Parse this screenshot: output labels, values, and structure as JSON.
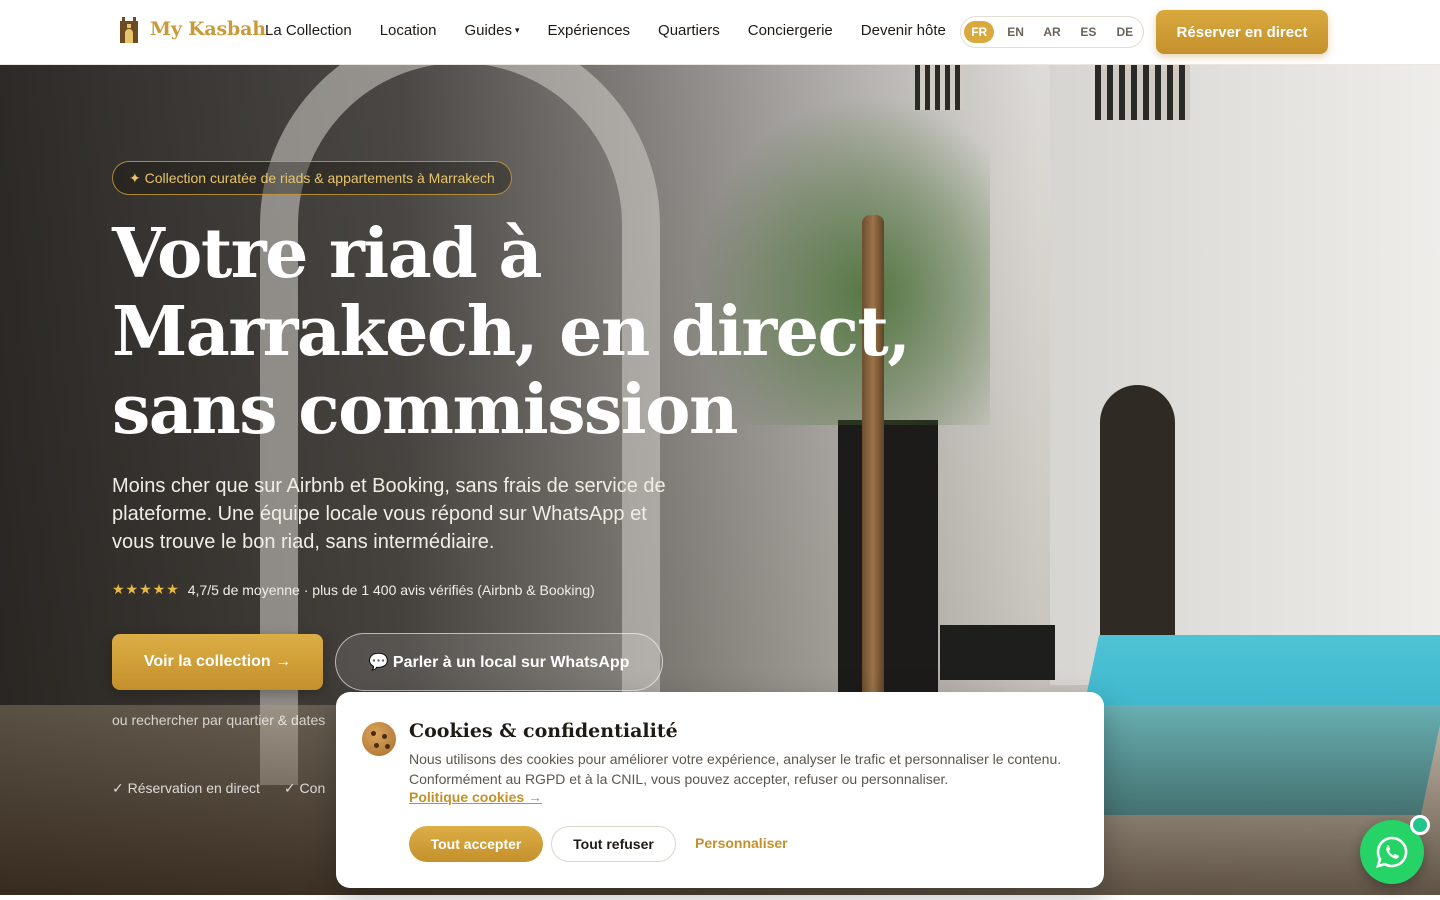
{
  "brand": {
    "name": "My Kasbah",
    "accent": "#d9a93d"
  },
  "nav": {
    "items": [
      "La Collection",
      "Location",
      "Guides",
      "Expériences",
      "Quartiers",
      "Conciergerie",
      "Devenir hôte"
    ],
    "guides_caret": "▾"
  },
  "lang": {
    "options": [
      "FR",
      "EN",
      "AR",
      "ES",
      "DE"
    ],
    "selected": "FR"
  },
  "header_cta": "Réserver en direct",
  "hero": {
    "badge": "✦ Collection curatée de riads & appartements à Marrakech",
    "title": "Votre riad à Marrakech, en direct, sans commission",
    "subtitle": "Moins cher que sur Airbnb et Booking, sans frais de service de plateforme. Une équipe locale vous répond sur WhatsApp et vous trouve le bon riad, sans intermédiaire.",
    "stars": "★★★★★",
    "rating_text": "4,7/5 de moyenne · plus de 1 400 avis vérifiés (Airbnb & Booking)",
    "primary_button": "Voir la collection →",
    "secondary_button": "💬 Parler à un local sur WhatsApp",
    "search_link": "ou rechercher par quartier & dates",
    "checks": [
      "✓ Réservation en direct",
      "✓ Con"
    ]
  },
  "cookie": {
    "title": "Cookies & confidentialité",
    "text": "Nous utilisons des cookies pour améliorer votre expérience, analyser le trafic et personnaliser le contenu. Conformément au RGPD et à la CNIL, vous pouvez accepter, refuser ou personnaliser.",
    "policy_link": "Politique cookies →",
    "accept": "Tout accepter",
    "refuse": "Tout refuser",
    "customize": "Personnaliser"
  },
  "whatsapp": {
    "icon": "whatsapp-icon",
    "color": "#25d366"
  }
}
